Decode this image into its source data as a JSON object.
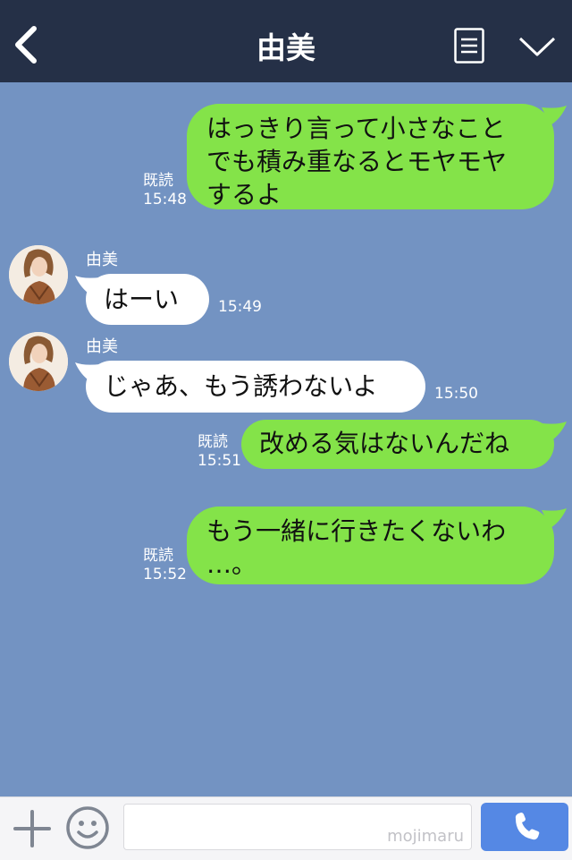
{
  "header": {
    "title": "由美",
    "back_icon": "chevron-left-icon",
    "menu_icon": "note-menu-icon",
    "collapse_icon": "chevron-down-icon"
  },
  "messages": [
    {
      "side": "me",
      "text": "はっきり言って小さなこと\nでも積み重なるとモヤモヤ\nするよ",
      "read": "既読",
      "time": "15:48"
    },
    {
      "side": "them",
      "sender": "由美",
      "text": "はーい",
      "time": "15:49"
    },
    {
      "side": "them",
      "sender": "由美",
      "text": "じゃあ、もう誘わないよ",
      "time": "15:50"
    },
    {
      "side": "me",
      "text": "改める気はないんだね",
      "read": "既読",
      "time": "15:51"
    },
    {
      "side": "me",
      "text": "もう一緒に行きたくないわ\n…。",
      "read": "既読",
      "time": "15:52"
    }
  ],
  "footer": {
    "plus_icon": "plus-icon",
    "emoji_icon": "smiley-icon",
    "input_value": "",
    "watermark": "mojimaru",
    "call_icon": "phone-icon"
  },
  "colors": {
    "header_bg": "#253047",
    "chat_bg": "#7393c2",
    "my_bubble": "#84e349",
    "their_bubble": "#ffffff",
    "call_button": "#5588e4"
  }
}
